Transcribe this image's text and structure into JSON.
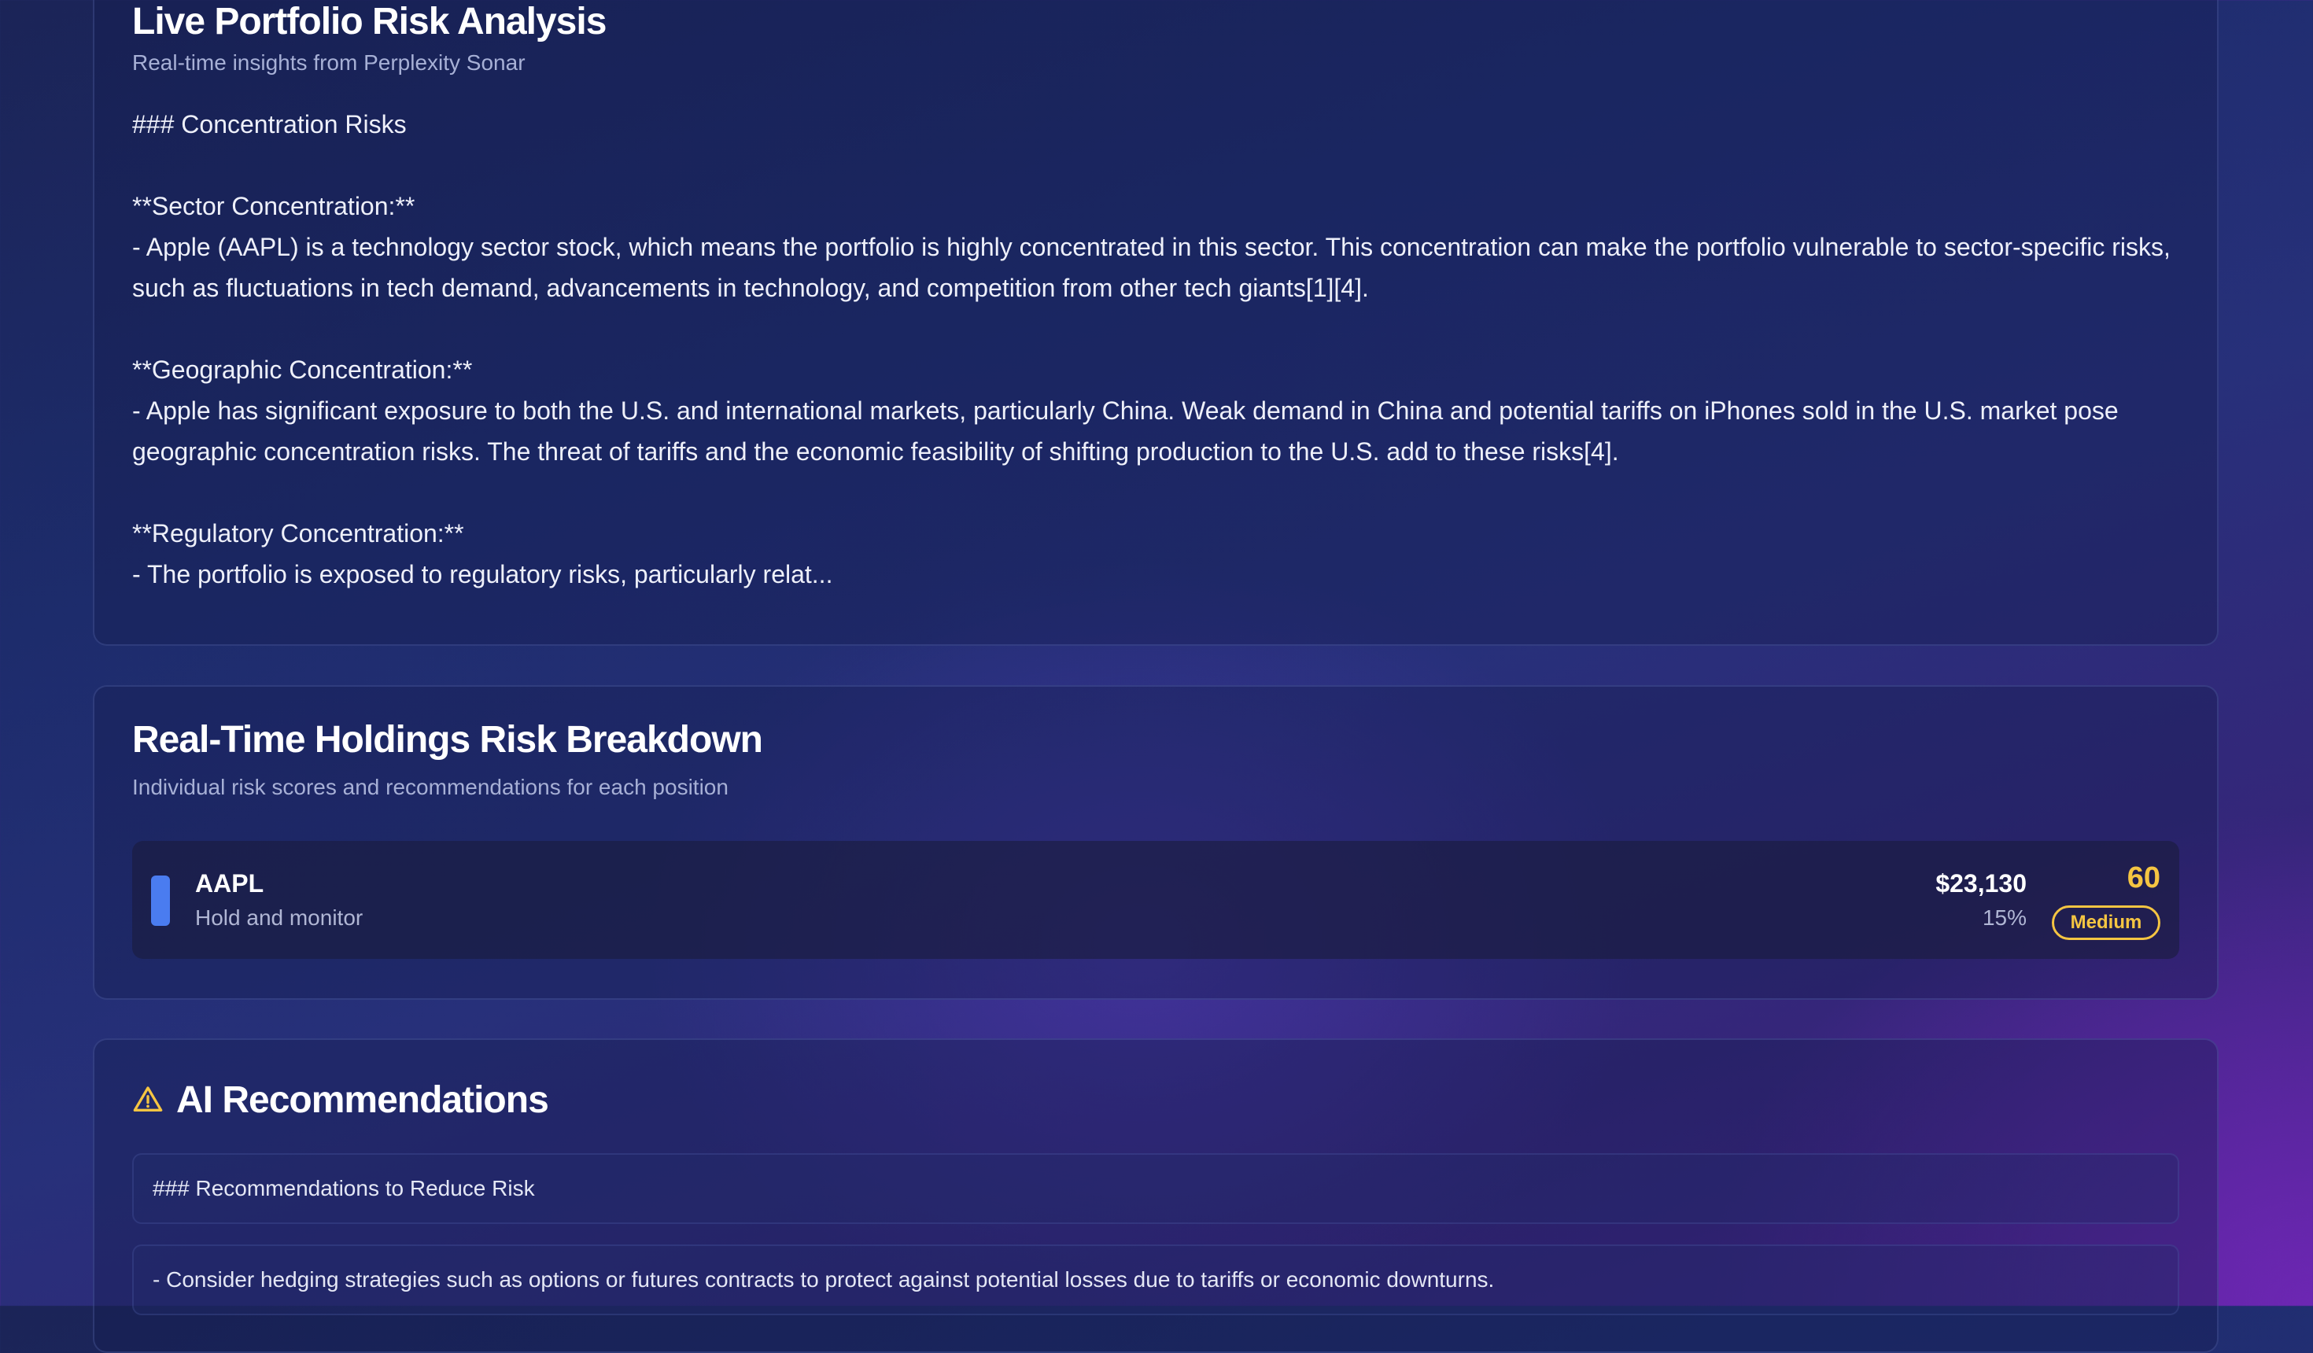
{
  "analysis": {
    "title": "Live Portfolio Risk Analysis",
    "subtitle": "Real-time insights from Perplexity Sonar",
    "body": "### Concentration Risks\n\n**Sector Concentration:**\n- Apple (AAPL) is a technology sector stock, which means the portfolio is highly concentrated in this sector. This concentration can make the portfolio vulnerable to sector-specific risks, such as fluctuations in tech demand, advancements in technology, and competition from other tech giants[1][4].\n\n**Geographic Concentration:**\n- Apple has significant exposure to both the U.S. and international markets, particularly China. Weak demand in China and potential tariffs on iPhones sold in the U.S. market pose geographic concentration risks. The threat of tariffs and the economic feasibility of shifting production to the U.S. add to these risks[4].\n\n**Regulatory Concentration:**\n- The portfolio is exposed to regulatory risks, particularly relat..."
  },
  "holdings": {
    "title": "Real-Time Holdings Risk Breakdown",
    "subtitle": "Individual risk scores and recommendations for each position",
    "items": [
      {
        "ticker": "AAPL",
        "recommendation": "Hold and monitor",
        "value": "$23,130",
        "weight": "15%",
        "risk_score": "60",
        "risk_level": "Medium",
        "colors": {
          "indicator": "#4a7cf0",
          "risk": "#f5c542"
        }
      }
    ]
  },
  "recommendations": {
    "icon": "warning-icon",
    "title": "AI Recommendations",
    "items": [
      "### Recommendations to Reduce Risk",
      "- Consider hedging strategies such as options or futures contracts to protect against potential losses due to tariffs or economic downturns."
    ]
  }
}
